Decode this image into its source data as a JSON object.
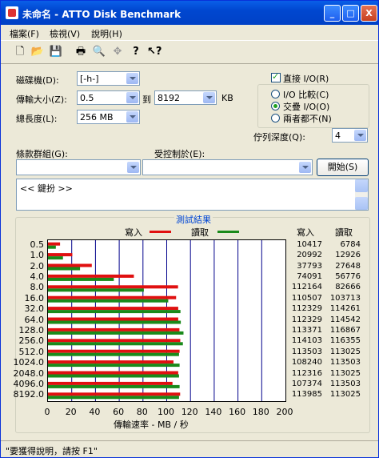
{
  "window": {
    "title": "未命名 - ATTO Disk Benchmark",
    "min_label": "_",
    "max_label": "□",
    "close_label": "X"
  },
  "menu": [
    "檔案(F)",
    "檢視(V)",
    "說明(H)"
  ],
  "toolbar": {
    "icons": [
      "new-file-icon",
      "open-folder-icon",
      "save-icon",
      "print-icon",
      "print-preview-icon",
      "move-icon",
      "help-icon",
      "context-help-icon"
    ]
  },
  "form": {
    "drive_label": "磁碟機(D):",
    "drive_value": "[-h-]",
    "transfer_label": "傳輸大小(Z):",
    "transfer_from": "0.5",
    "transfer_to_label": "到",
    "transfer_to": "8192",
    "transfer_unit": "KB",
    "total_label": "總長度(L):",
    "total_value": "256 MB",
    "direct_io_label": "直接 I/O(R)",
    "direct_io_checked": true,
    "io_compare_label": "I/O 比較(C)",
    "overlap_io_label": "交疊 I/O(O)",
    "neither_label": "兩者都不(N)",
    "queue_label": "佇列深度(Q):",
    "queue_value": "4",
    "controlled_by_label": "受控制於(E):",
    "group_label": "條款群組(G):",
    "start_button": "開始(S)",
    "notes": "<< 鍵扮 >>"
  },
  "results": {
    "title": "測試結果",
    "legend_write": "寫入",
    "legend_read": "讀取",
    "col_write": "寫入",
    "col_read": "讀取",
    "xlabel": "傳輸速率 - MB / 秒"
  },
  "colors": {
    "write": "#E01010",
    "read": "#1A8A1A"
  },
  "chart_data": {
    "type": "bar",
    "categories": [
      "0.5",
      "1.0",
      "2.0",
      "4.0",
      "8.0",
      "16.0",
      "32.0",
      "64.0",
      "128.0",
      "256.0",
      "512.0",
      "1024.0",
      "2048.0",
      "4096.0",
      "8192.0"
    ],
    "series": [
      {
        "name": "寫入",
        "values": [
          10417,
          20992,
          37793,
          74091,
          112164,
          110507,
          112329,
          112329,
          113371,
          114103,
          113503,
          108240,
          112316,
          107374,
          113985
        ]
      },
      {
        "name": "讀取",
        "values": [
          6784,
          12926,
          27648,
          56776,
          82666,
          103713,
          114261,
          114542,
          116867,
          116355,
          113025,
          113503,
          113025,
          113503,
          113025
        ]
      }
    ],
    "xticks": [
      "0",
      "20",
      "40",
      "60",
      "80",
      "100",
      "120",
      "140",
      "160",
      "180",
      "200"
    ],
    "xlim": [
      0,
      200
    ],
    "xlabel": "傳輸速率 - MB / 秒",
    "grid": true
  },
  "status": {
    "text": "\"要獲得說明，請按 F1\""
  }
}
